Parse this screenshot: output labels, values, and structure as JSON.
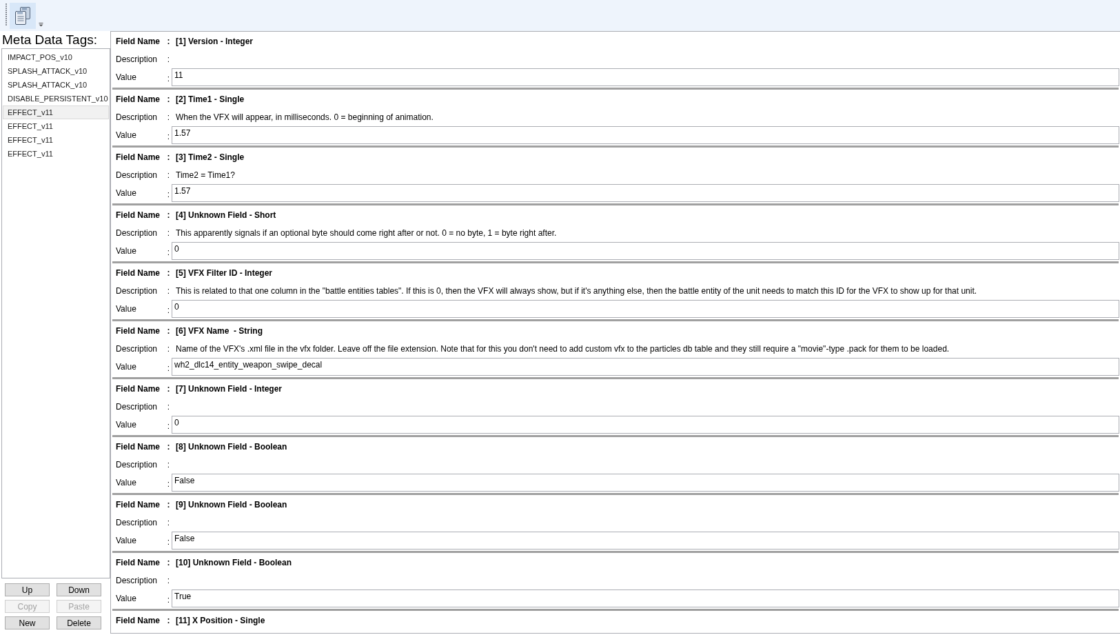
{
  "sidebar": {
    "title": "Meta Data Tags:",
    "items": [
      {
        "label": "IMPACT_POS_v10",
        "selected": false
      },
      {
        "label": "SPLASH_ATTACK_v10",
        "selected": false
      },
      {
        "label": "SPLASH_ATTACK_v10",
        "selected": false
      },
      {
        "label": "DISABLE_PERSISTENT_v10",
        "selected": false
      },
      {
        "label": "EFFECT_v11",
        "selected": true
      },
      {
        "label": "EFFECT_v11",
        "selected": false
      },
      {
        "label": "EFFECT_v11",
        "selected": false
      },
      {
        "label": "EFFECT_v11",
        "selected": false
      }
    ]
  },
  "buttons": [
    {
      "label": "Up",
      "disabled": false
    },
    {
      "label": "Down",
      "disabled": false
    },
    {
      "label": "Copy",
      "disabled": true
    },
    {
      "label": "Paste",
      "disabled": true
    },
    {
      "label": "New",
      "disabled": false
    },
    {
      "label": "Delete",
      "disabled": false
    }
  ],
  "fields": [
    {
      "rows": [
        {
          "kind": "name",
          "label": "Field Name",
          "colon": ":",
          "text": "[1] Version - Integer"
        },
        {
          "kind": "description",
          "label": "Description",
          "colon": ":"
        },
        {
          "kind": "value",
          "label": "Value",
          "colon": ":",
          "value": "11"
        }
      ]
    },
    {
      "rows": [
        {
          "kind": "name",
          "label": "Field Name",
          "colon": ":",
          "text": "[2] Time1 - Single"
        },
        {
          "kind": "description",
          "label": "Description",
          "colon": ":",
          "text": "When the VFX will appear, in milliseconds. 0 = beginning of animation."
        },
        {
          "kind": "value",
          "label": "Value",
          "colon": ":",
          "value": "1.57"
        }
      ]
    },
    {
      "rows": [
        {
          "kind": "name",
          "label": "Field Name",
          "colon": ":",
          "text": "[3] Time2 - Single"
        },
        {
          "kind": "description",
          "label": "Description",
          "colon": ":",
          "text": "Time2 = Time1?"
        },
        {
          "kind": "value",
          "label": "Value",
          "colon": ":",
          "value": "1.57"
        }
      ]
    },
    {
      "rows": [
        {
          "kind": "name",
          "label": "Field Name",
          "colon": ":",
          "text": "[4] Unknown Field - Short"
        },
        {
          "kind": "description",
          "label": "Description",
          "colon": ":",
          "text": "This apparently signals if an optional byte should come right after or not. 0 = no byte, 1 = byte right after."
        },
        {
          "kind": "value",
          "label": "Value",
          "colon": ":",
          "value": "0"
        }
      ]
    },
    {
      "rows": [
        {
          "kind": "name",
          "label": "Field Name",
          "colon": ":",
          "text": "[5] VFX Filter ID - Integer"
        },
        {
          "kind": "description",
          "label": "Description",
          "colon": ":",
          "text": "This is related to that one column in the \"battle entities tables\". If this is 0, then the VFX will always show, but if it's anything else, then the battle entity of the unit needs to match this ID for the VFX to show up for that unit."
        },
        {
          "kind": "value",
          "label": "Value",
          "colon": ":",
          "value": "0"
        }
      ]
    },
    {
      "rows": [
        {
          "kind": "name",
          "label": "Field Name",
          "colon": ":",
          "text": "[6] VFX Name  - String"
        },
        {
          "kind": "description",
          "label": "Description",
          "colon": ":",
          "text": "Name of the VFX's .xml file in the vfx folder. Leave off the file extension. Note that for this you don't need to add custom vfx to the particles db table and they still require a \"movie\"-type .pack for them to be loaded."
        },
        {
          "kind": "value",
          "label": "Value",
          "colon": ":",
          "value": "wh2_dlc14_entity_weapon_swipe_decal"
        }
      ]
    },
    {
      "rows": [
        {
          "kind": "name",
          "label": "Field Name",
          "colon": ":",
          "text": "[7] Unknown Field - Integer"
        },
        {
          "kind": "description",
          "label": "Description",
          "colon": ":"
        },
        {
          "kind": "value",
          "label": "Value",
          "colon": ":",
          "value": "0"
        }
      ]
    },
    {
      "rows": [
        {
          "kind": "name",
          "label": "Field Name",
          "colon": ":",
          "text": "[8] Unknown Field - Boolean"
        },
        {
          "kind": "description",
          "label": "Description",
          "colon": ":"
        },
        {
          "kind": "value",
          "label": "Value",
          "colon": ":",
          "value": "False"
        }
      ]
    },
    {
      "rows": [
        {
          "kind": "name",
          "label": "Field Name",
          "colon": ":",
          "text": "[9] Unknown Field - Boolean"
        },
        {
          "kind": "description",
          "label": "Description",
          "colon": ":"
        },
        {
          "kind": "value",
          "label": "Value",
          "colon": ":",
          "value": "False"
        }
      ]
    },
    {
      "rows": [
        {
          "kind": "name",
          "label": "Field Name",
          "colon": ":",
          "text": "[10] Unknown Field - Boolean"
        },
        {
          "kind": "description",
          "label": "Description",
          "colon": ":"
        },
        {
          "kind": "value",
          "label": "Value",
          "colon": ":",
          "value": "True"
        }
      ]
    },
    {
      "rows": [
        {
          "kind": "name",
          "label": "Field Name",
          "colon": ":",
          "text": "[11] X Position - Single"
        }
      ]
    }
  ]
}
